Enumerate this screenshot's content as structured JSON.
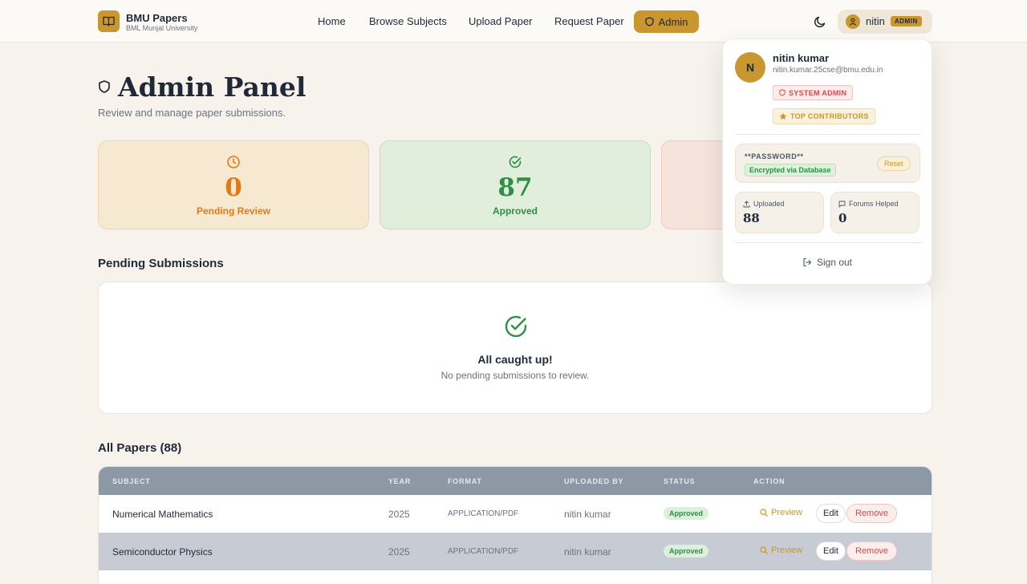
{
  "nav": {
    "brand_title": "BMU Papers",
    "brand_sub": "BML Munjal University",
    "links": [
      "Home",
      "Browse Subjects",
      "Upload Paper",
      "Request Paper"
    ],
    "admin_label": "Admin",
    "user_name": "nitin",
    "user_role_tag": "ADMIN"
  },
  "header": {
    "title": "Admin Panel",
    "subtitle": "Review and manage paper submissions."
  },
  "stats": {
    "pending": {
      "value": "0",
      "label": "Pending Review"
    },
    "approved": {
      "value": "87",
      "label": "Approved"
    }
  },
  "pending_section": {
    "title": "Pending Submissions",
    "empty_title": "All caught up!",
    "empty_sub": "No pending submissions to review."
  },
  "papers": {
    "title": "All Papers (88)",
    "headers": [
      "SUBJECT",
      "YEAR",
      "FORMAT",
      "UPLOADED BY",
      "STATUS",
      "ACTION"
    ],
    "rows": [
      {
        "subject": "Numerical Mathematics",
        "year": "2025",
        "format": "APPLICATION/PDF",
        "uploaded_by": "nitin kumar",
        "status": "Approved"
      },
      {
        "subject": "Semiconductor Physics",
        "year": "2025",
        "format": "APPLICATION/PDF",
        "uploaded_by": "nitin kumar",
        "status": "Approved"
      }
    ],
    "actions": {
      "preview": "Preview",
      "edit": "Edit",
      "remove": "Remove"
    }
  },
  "profile_menu": {
    "initial": "N",
    "name": "nitin kumar",
    "email": "nitin.kumar.25cse@bmu.edu.in",
    "badge_system": "SYSTEM ADMIN",
    "badge_top": "TOP CONTRIBUTORS",
    "password_label": "**PASSWORD**",
    "password_status": "Encrypted via Database",
    "reset_label": "Reset",
    "uploaded_label": "Uploaded",
    "uploaded_value": "88",
    "forums_label": "Forums Helped",
    "forums_value": "0",
    "signout_label": "Sign out"
  },
  "colors": {
    "accent": "#c9962f",
    "background": "#f7f3ec",
    "approved_green": "#2f8f46",
    "pending_orange": "#e07b14",
    "danger_red": "#d9484a"
  }
}
